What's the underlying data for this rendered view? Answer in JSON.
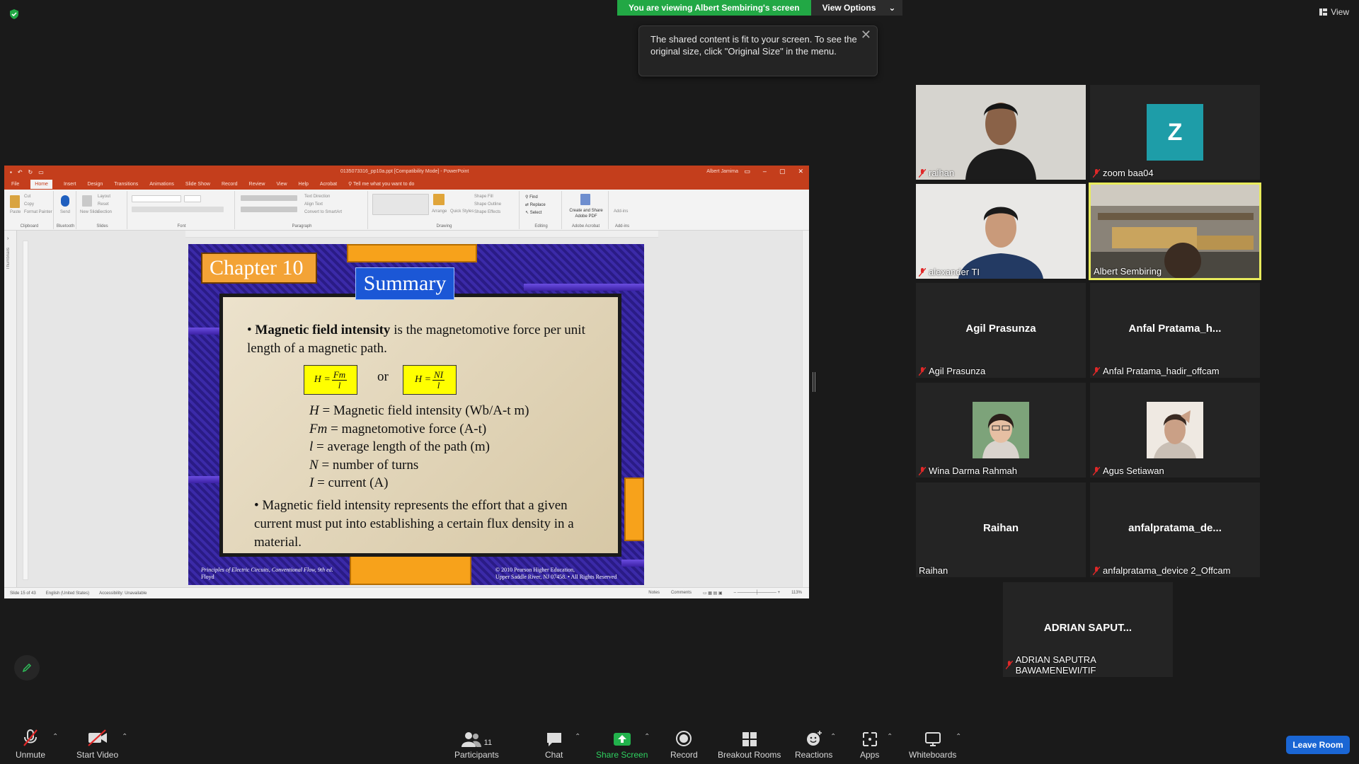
{
  "top": {
    "viewing_banner": "You are viewing Albert Sembiring's screen",
    "view_options": "View Options",
    "tooltip_text": "The shared content is fit to your screen. To see the original size, click \"Original Size\" in the menu.",
    "view_label": "View"
  },
  "ppt": {
    "file_title": "0135073316_pp10a.ppt [Compatibility Mode] - PowerPoint",
    "user": "Albert Jamima",
    "tabs": [
      "File",
      "Home",
      "Insert",
      "Design",
      "Transitions",
      "Animations",
      "Slide Show",
      "Record",
      "Review",
      "View",
      "Help",
      "Acrobat"
    ],
    "tell_me": "Tell me what you want to do",
    "ribbon_groups": [
      "Clipboard",
      "Bluetooth",
      "Slides",
      "Font",
      "Paragraph",
      "Drawing",
      "Editing",
      "Adobe Acrobat",
      "Add-ins"
    ],
    "ribbon_buttons": {
      "paste": "Paste",
      "cut": "Cut",
      "copy": "Copy",
      "format_painter": "Format Painter",
      "send": "Send",
      "new_slide": "New Slide",
      "layout": "Layout",
      "reset": "Reset",
      "section": "Section",
      "text_direction": "Text Direction",
      "align_text": "Align Text",
      "convert_smartart": "Convert to SmartArt",
      "arrange": "Arrange",
      "quick_styles": "Quick Styles",
      "shape_fill": "Shape Fill",
      "shape_outline": "Shape Outline",
      "shape_effects": "Shape Effects",
      "find": "Find",
      "replace": "Replace",
      "select": "Select",
      "create_share_pdf": "Create and Share Adobe PDF",
      "add_ins": "Add-ins"
    },
    "thumbnails_label": "Thumbnails",
    "status": {
      "slide": "Slide 15 of 43",
      "language": "English (United States)",
      "accessibility": "Accessibility: Unavailable",
      "notes": "Notes",
      "comments": "Comments",
      "zoom": "113%"
    },
    "slide": {
      "chapter": "Chapter 10",
      "summary": "Summary",
      "p1_bold": "Magnetic field intensity",
      "p1_rest": " is the magnetomotive force per unit length of a magnetic path.",
      "f1_lhs": "H =",
      "f1_num": "Fm",
      "f1_den": "l",
      "or": "or",
      "f2_lhs": "H =",
      "f2_num": "NI",
      "f2_den": "l",
      "defs": [
        {
          "sym": "H",
          "text": " = Magnetic field intensity (Wb/A-t m)"
        },
        {
          "sym": "Fm",
          "text": " = magnetomotive force (A-t)"
        },
        {
          "sym": "l",
          "text": " = average length of the path (m)"
        },
        {
          "sym": "N",
          "text": " = number of turns"
        },
        {
          "sym": "I",
          "text": " = current (A)"
        }
      ],
      "p2": "• Magnetic field intensity represents the effort that a given current must put into establishing a certain flux density in a material.",
      "footer_left_1": "Principles of Electric Circuits, Conventional Flow, 9th ed.",
      "footer_left_2": "Floyd",
      "footer_right_1": "© 2010 Pearson Higher Education,",
      "footer_right_2": "Upper Saddle River, NJ 07458. • All Rights Reserved"
    }
  },
  "participants": [
    {
      "name": "raihan",
      "type": "video"
    },
    {
      "name": "zoom baa04",
      "type": "avatar",
      "initial": "Z"
    },
    {
      "name": "alexander TI",
      "type": "video"
    },
    {
      "name": "Albert Sembiring",
      "type": "video",
      "active": true
    },
    {
      "name": "Agil Prasunza",
      "type": "name",
      "display": "Agil Prasunza"
    },
    {
      "name": "Anfal Pratama_hadir_offcam",
      "type": "name",
      "display": "Anfal  Pratama_h..."
    },
    {
      "name": "Wina Darma Rahmah",
      "type": "photo"
    },
    {
      "name": "Agus Setiawan",
      "type": "photo"
    },
    {
      "name": "Raihan",
      "type": "name",
      "display": "Raihan"
    },
    {
      "name": "anfalpratama_device 2_Offcam",
      "type": "name",
      "display": "anfalpratama_de..."
    },
    {
      "name": "ADRIAN SAPUTRA BAWAMENEWI/TIF",
      "type": "name",
      "display": "ADRIAN  SAPUT..."
    }
  ],
  "toolbar": {
    "unmute": "Unmute",
    "start_video": "Start Video",
    "participants": "Participants",
    "participants_count": "11",
    "chat": "Chat",
    "share_screen": "Share Screen",
    "record": "Record",
    "breakout_rooms": "Breakout Rooms",
    "reactions": "Reactions",
    "apps": "Apps",
    "whiteboards": "Whiteboards",
    "leave_room": "Leave Room"
  },
  "colors": {
    "zoom_green": "#22a845",
    "ppt_red": "#c43e1c",
    "leave_blue": "#1a66d4",
    "active_speaker": "#e8eb5c",
    "avatar_teal": "#1e9da8"
  }
}
